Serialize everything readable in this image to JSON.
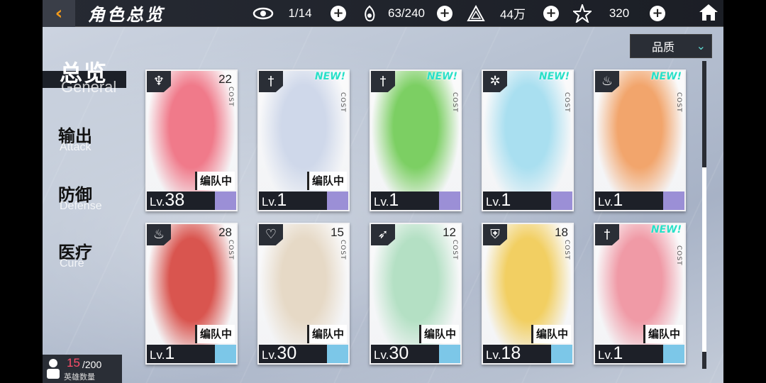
{
  "header": {
    "title": "角色总览",
    "resources": [
      {
        "icon": "eye-icon",
        "value": "1/14"
      },
      {
        "icon": "stamina-icon",
        "value": "63/240"
      },
      {
        "icon": "gold-icon",
        "value": "44万"
      },
      {
        "icon": "star-crystal-icon",
        "value": "320"
      }
    ]
  },
  "sidebar": {
    "category_title": "总览",
    "category_title_en": "General",
    "items": [
      {
        "label": "输出",
        "label_en": "Attack"
      },
      {
        "label": "防御",
        "label_en": "Defense"
      },
      {
        "label": "医疗",
        "label_en": "Cure"
      }
    ]
  },
  "sort": {
    "label": "品质"
  },
  "cost_label": "COST",
  "team_label": "编队中",
  "new_label": "NEW!",
  "lv_prefix": "Lv.",
  "cards": [
    {
      "role_icon": "demon-icon",
      "cost": "22",
      "is_new": false,
      "in_team": true,
      "level": "38",
      "tier_color": "#9b8fd6",
      "art": "#f07a8a"
    },
    {
      "role_icon": "sword-icon",
      "cost": "",
      "is_new": true,
      "in_team": true,
      "level": "1",
      "tier_color": "#9b8fd6",
      "art": "#cfd8ea"
    },
    {
      "role_icon": "sword-icon",
      "cost": "",
      "is_new": true,
      "in_team": false,
      "level": "1",
      "tier_color": "#9b8fd6",
      "art": "#7ccf63"
    },
    {
      "role_icon": "flower-icon",
      "cost": "",
      "is_new": true,
      "in_team": false,
      "level": "1",
      "tier_color": "#9b8fd6",
      "art": "#a9dff0"
    },
    {
      "role_icon": "flame-icon",
      "cost": "",
      "is_new": true,
      "in_team": false,
      "level": "1",
      "tier_color": "#9b8fd6",
      "art": "#f2a56c"
    },
    {
      "role_icon": "flame-icon",
      "cost": "28",
      "is_new": false,
      "in_team": true,
      "level": "1",
      "tier_color": "#7cc7e8",
      "art": "#d9554f"
    },
    {
      "role_icon": "heart-icon",
      "cost": "15",
      "is_new": false,
      "in_team": true,
      "level": "30",
      "tier_color": "#7cc7e8",
      "art": "#e6d9c6"
    },
    {
      "role_icon": "bow-icon",
      "cost": "12",
      "is_new": false,
      "in_team": true,
      "level": "30",
      "tier_color": "#7cc7e8",
      "art": "#b4e0c4"
    },
    {
      "role_icon": "shield-icon",
      "cost": "18",
      "is_new": false,
      "in_team": true,
      "level": "18",
      "tier_color": "#7cc7e8",
      "art": "#f2cf62"
    },
    {
      "role_icon": "sword-icon",
      "cost": "",
      "is_new": true,
      "in_team": true,
      "level": "1",
      "tier_color": "#7cc7e8",
      "art": "#f09aa6"
    }
  ],
  "hero_count": {
    "current": "15",
    "max": "/200",
    "label": "英雄数量"
  }
}
